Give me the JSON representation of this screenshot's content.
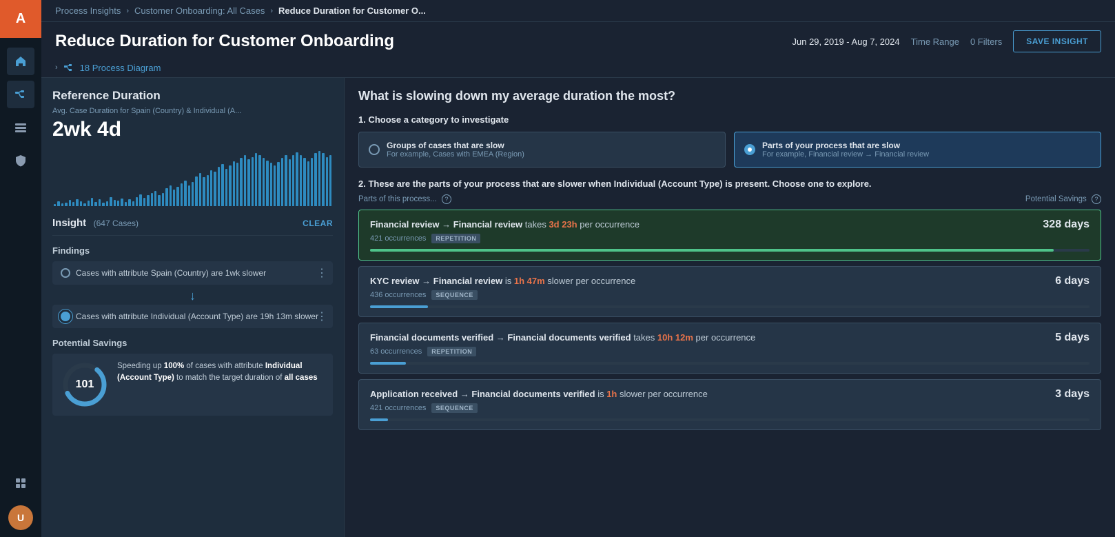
{
  "brand": {
    "logo_text": "A"
  },
  "nav": {
    "home_icon": "⌂",
    "toggle_icon": "⇄",
    "data_icon": "▤",
    "shield_icon": "🛡",
    "grid_icon": "⋮⋮"
  },
  "breadcrumb": {
    "part1": "Process Insights",
    "part2": "Customer Onboarding: All Cases",
    "part3": "Reduce Duration for Customer O..."
  },
  "header": {
    "title": "Reduce Duration for Customer Onboarding",
    "date_range": "Jun 29, 2019 - Aug 7, 2024",
    "date_label": "Time Range",
    "filters": "0 Filters",
    "save_btn": "SAVE INSIGHT"
  },
  "process_diagram": {
    "label": "18 Process Diagram",
    "icon": "🔀"
  },
  "left_panel": {
    "ref_duration_title": "Reference Duration",
    "ref_subtitle": "Avg. Case Duration for Spain (Country) & Individual (A...",
    "ref_value": "2wk 4d",
    "insight_title": "Insight",
    "insight_count": "(647 Cases)",
    "clear_btn": "CLEAR",
    "findings_title": "Findings",
    "findings": [
      {
        "id": "finding-1",
        "text": "Cases with attribute Spain (Country) are 1wk slower",
        "selected": false
      },
      {
        "id": "finding-2",
        "text": "Cases with attribute Individual (Account Type) are 19h 13m slower",
        "selected": true
      }
    ],
    "potential_savings_title": "Potential Savings",
    "savings_number": "101",
    "savings_text_1": "Speeding up",
    "savings_bold_1": "100%",
    "savings_text_2": "of cases with attribute",
    "savings_bold_2": "Individual (Account Type)",
    "savings_text_3": "to match the target duration of",
    "savings_bold_3": "all cases"
  },
  "right_panel": {
    "title": "What is slowing down my average duration the most?",
    "section1_label": "1. Choose a category to investigate",
    "option1_title": "Groups of cases that are slow",
    "option1_subtitle": "For example, Cases with EMEA (Region)",
    "option2_title": "Parts of your process that are slow",
    "option2_subtitle": "For example, Financial review → Financial review",
    "section2_label": "2. These are the parts of your process that are slower when Individual (Account Type) is present. Choose one to explore.",
    "parts_label": "Parts of this process...",
    "potential_savings_label": "Potential Savings",
    "rows": [
      {
        "id": "row-1",
        "bold_from": "Financial review",
        "arrow": "→",
        "bold_to": "Financial review",
        "verb": "takes",
        "time": "3d 23h",
        "rest": "per occurrence",
        "occurrences": "421 occurrences",
        "badge": "REPETITION",
        "days": "328 days",
        "progress": 95,
        "selected": true
      },
      {
        "id": "row-2",
        "bold_from": "KYC review",
        "arrow": "→",
        "bold_to": "Financial review",
        "verb": "is",
        "time": "1h 47m",
        "rest": "slower per occurrence",
        "occurrences": "436 occurrences",
        "badge": "SEQUENCE",
        "days": "6 days",
        "progress": 8,
        "selected": false
      },
      {
        "id": "row-3",
        "bold_from": "Financial documents verified",
        "arrow": "→",
        "bold_to": "Financial documents verified",
        "verb": "takes",
        "time": "10h 12m",
        "rest": "per occurrence",
        "occurrences": "63 occurrences",
        "badge": "REPETITION",
        "days": "5 days",
        "progress": 5,
        "selected": false
      },
      {
        "id": "row-4",
        "bold_from": "Application received",
        "arrow": "→",
        "bold_to": "Financial documents verified",
        "verb": "is",
        "time": "1h",
        "rest": "slower per occurrence",
        "occurrences": "421 occurrences",
        "badge": "SEQUENCE",
        "days": "3 days",
        "progress": 2,
        "selected": false
      }
    ]
  },
  "chart_bars": [
    4,
    8,
    5,
    6,
    10,
    7,
    12,
    8,
    5,
    9,
    14,
    7,
    11,
    6,
    8,
    15,
    10,
    9,
    13,
    7,
    11,
    8,
    15,
    20,
    14,
    18,
    22,
    25,
    18,
    22,
    30,
    35,
    28,
    32,
    38,
    42,
    35,
    40,
    50,
    55,
    48,
    52,
    60,
    58,
    65,
    70,
    62,
    68,
    75,
    72,
    80,
    85,
    78,
    82,
    88,
    85,
    80,
    76,
    72,
    68,
    74,
    80,
    85,
    78,
    85,
    90,
    85,
    80,
    75,
    80,
    88,
    92,
    88,
    82,
    85
  ]
}
